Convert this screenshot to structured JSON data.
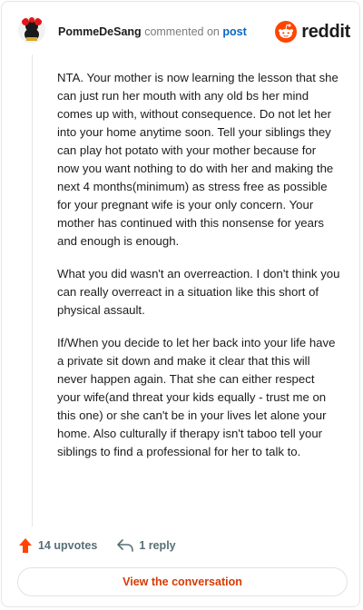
{
  "comment": {
    "username": "PommeDeSang",
    "action_text": "commented on",
    "post_link": "post",
    "paragraphs": [
      "NTA. Your mother is now learning the lesson that she can just run her mouth with any old bs her mind comes up with, without consequence. Do not let her into your home anytime soon. Tell your siblings they can play hot potato with your mother because for now you want nothing to do with her and making the next 4 months(minimum) as stress free as possible for your pregnant wife is your only concern. Your mother has continued with this nonsense for years and enough is enough.",
      "What you did wasn't an overreaction. I don't think you can really overreact in a situation like this short of physical assault.",
      "If/When you decide to let her back into your life have a private sit down and make it clear that this will never happen again. That she can either respect your wife(and threat your kids equally - trust me on this one) or she can't be in your lives let alone your home. Also culturally if therapy isn't taboo tell your siblings to find a professional for her to talk to."
    ],
    "upvotes_label": "14 upvotes",
    "reply_label": "1 reply",
    "view_conversation_label": "View the conversation"
  },
  "brand": {
    "wordmark": "reddit",
    "color": "#ff4500"
  },
  "icons": {
    "upvote": "upvote-arrow-icon",
    "reply": "reply-arrow-icon",
    "reddit": "reddit-logo-icon",
    "avatar": "snoo-avatar-icon"
  },
  "colors": {
    "accent": "#d93a00",
    "link": "#0a66c2",
    "upvote": "#ff4500",
    "text": "#1c1c1c",
    "muted": "#576f76"
  }
}
